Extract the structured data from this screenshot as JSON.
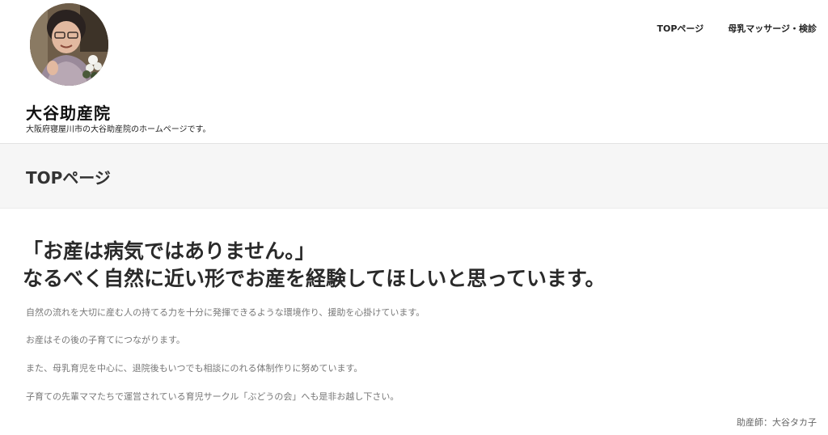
{
  "site": {
    "title": "大谷助産院",
    "tagline": "大阪府寝屋川市の大谷助産院のホームページです。"
  },
  "nav": {
    "items": [
      {
        "label": "TOPページ"
      },
      {
        "label": "母乳マッサージ・検診"
      }
    ]
  },
  "page": {
    "title": "TOPページ"
  },
  "content": {
    "headline_line1": "「お産は病気ではありません。」",
    "headline_line2": "なるべく自然に近い形でお産を経験してほしいと思っています。",
    "paragraphs": [
      "自然の流れを大切に産む人の持てる力を十分に発揮できるような環境作り、援助を心掛けています。",
      "お産はその後の子育てにつながります。",
      "また、母乳育児を中心に、退院後もいつでも相談にのれる体制作りに努めています。",
      "子育ての先輩ママたちで運営されている育児サークル「ぶどうの会」へも是非お越し下さい。"
    ],
    "signature": "助産師：大谷タカ子"
  },
  "colors": {
    "background": "#ffffff",
    "title_band": "#f6f6f6",
    "body_text": "#777777",
    "heading_text": "#2a2a2a"
  }
}
